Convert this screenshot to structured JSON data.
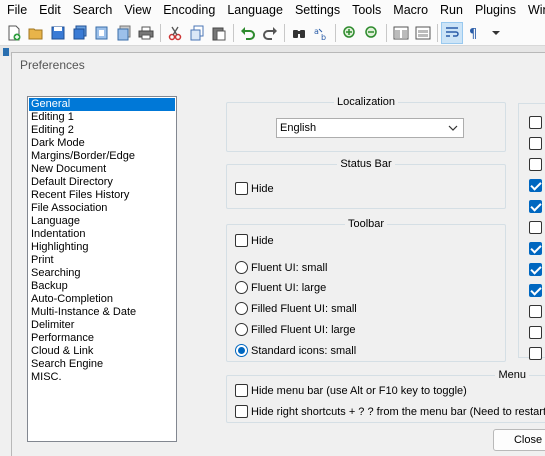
{
  "menubar": {
    "items": [
      "File",
      "Edit",
      "Search",
      "View",
      "Encoding",
      "Language",
      "Settings",
      "Tools",
      "Macro",
      "Run",
      "Plugins",
      "Win"
    ]
  },
  "toolbar": {
    "icons": [
      "new-file-icon",
      "open-folder-icon",
      "save-icon",
      "save-all-icon",
      "close-icon",
      "close-all-icon",
      "print-icon",
      "cut-icon",
      "copy-icon",
      "paste-icon",
      "undo-icon",
      "redo-icon",
      "find-icon",
      "replace-icon",
      "zoom-in-icon",
      "zoom-out-icon",
      "sync-vertical-icon",
      "sync-horizontal-icon",
      "word-wrap-icon",
      "show-all-chars-icon",
      "dropdown-icon"
    ]
  },
  "dialog": {
    "title": "Preferences",
    "categories": [
      "General",
      "Editing 1",
      "Editing 2",
      "Dark Mode",
      "Margins/Border/Edge",
      "New Document",
      "Default Directory",
      "Recent Files History",
      "File Association",
      "Language",
      "Indentation",
      "Highlighting",
      "Print",
      "Searching",
      "Backup",
      "Auto-Completion",
      "Multi-Instance & Date",
      "Delimiter",
      "Performance",
      "Cloud & Link",
      "Search Engine",
      "MISC."
    ],
    "selected_category": "General",
    "localization": {
      "title": "Localization",
      "value": "English"
    },
    "status_bar": {
      "title": "Status Bar",
      "hide_label": "Hide"
    },
    "toolbar_group": {
      "title": "Toolbar",
      "hide_label": "Hide",
      "options": [
        "Fluent UI: small",
        "Fluent UI: large",
        "Filled Fluent UI: small",
        "Filled Fluent UI: large",
        "Standard icons: small"
      ],
      "selected": "Standard icons: small"
    },
    "menu_group": {
      "title": "Menu",
      "hide_menu_bar_label": "Hide menu bar (use Alt or F10 key to toggle)",
      "hide_shortcuts_label": "Hide right shortcuts + ? ? from the menu bar (Need to restart"
    },
    "right_column_checks": [
      false,
      false,
      false,
      true,
      true,
      false,
      true,
      true,
      true,
      false,
      false,
      false
    ],
    "close_label": "Close"
  },
  "colors": {
    "accent": "#0078d7",
    "radio_accent": "#0067c0"
  }
}
